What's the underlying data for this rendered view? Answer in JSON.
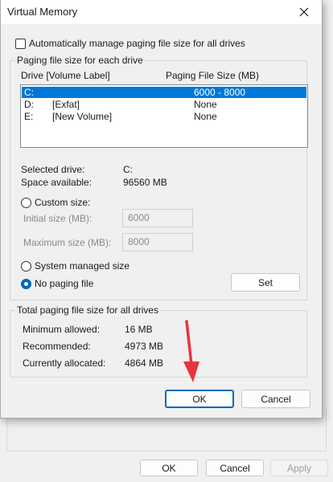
{
  "background_dialog": {
    "ok_label": "OK",
    "cancel_label": "Cancel",
    "apply_label": "Apply"
  },
  "dialog": {
    "title": "Virtual Memory",
    "auto_manage_label": "Automatically manage paging file size for all drives",
    "auto_manage_checked": false,
    "paging_group": {
      "title": "Paging file size for each drive",
      "col_drive": "Drive  [Volume Label]",
      "col_size": "Paging File Size (MB)",
      "drives": [
        {
          "drive": "C:",
          "label": "",
          "size": "6000 - 8000",
          "selected": true
        },
        {
          "drive": "D:",
          "label": "[Exfat]",
          "size": "None",
          "selected": false
        },
        {
          "drive": "E:",
          "label": "[New Volume]",
          "size": "None",
          "selected": false
        }
      ],
      "selected_drive_label": "Selected drive:",
      "selected_drive_value": "C:",
      "space_available_label": "Space available:",
      "space_available_value": "96560 MB",
      "custom_size_label": "Custom size:",
      "initial_size_label": "Initial size (MB):",
      "initial_size_value": "6000",
      "maximum_size_label": "Maximum size (MB):",
      "maximum_size_value": "8000",
      "system_managed_label": "System managed size",
      "no_paging_label": "No paging file",
      "selected_option": "no_paging",
      "set_label": "Set"
    },
    "total_group": {
      "title": "Total paging file size for all drives",
      "minimum_label": "Minimum allowed:",
      "minimum_value": "16 MB",
      "recommended_label": "Recommended:",
      "recommended_value": "4973 MB",
      "allocated_label": "Currently allocated:",
      "allocated_value": "4864 MB"
    },
    "ok_label": "OK",
    "cancel_label": "Cancel"
  },
  "colors": {
    "selection": "#0078d7",
    "accent": "#0067c0",
    "arrow": "#e8343a"
  }
}
